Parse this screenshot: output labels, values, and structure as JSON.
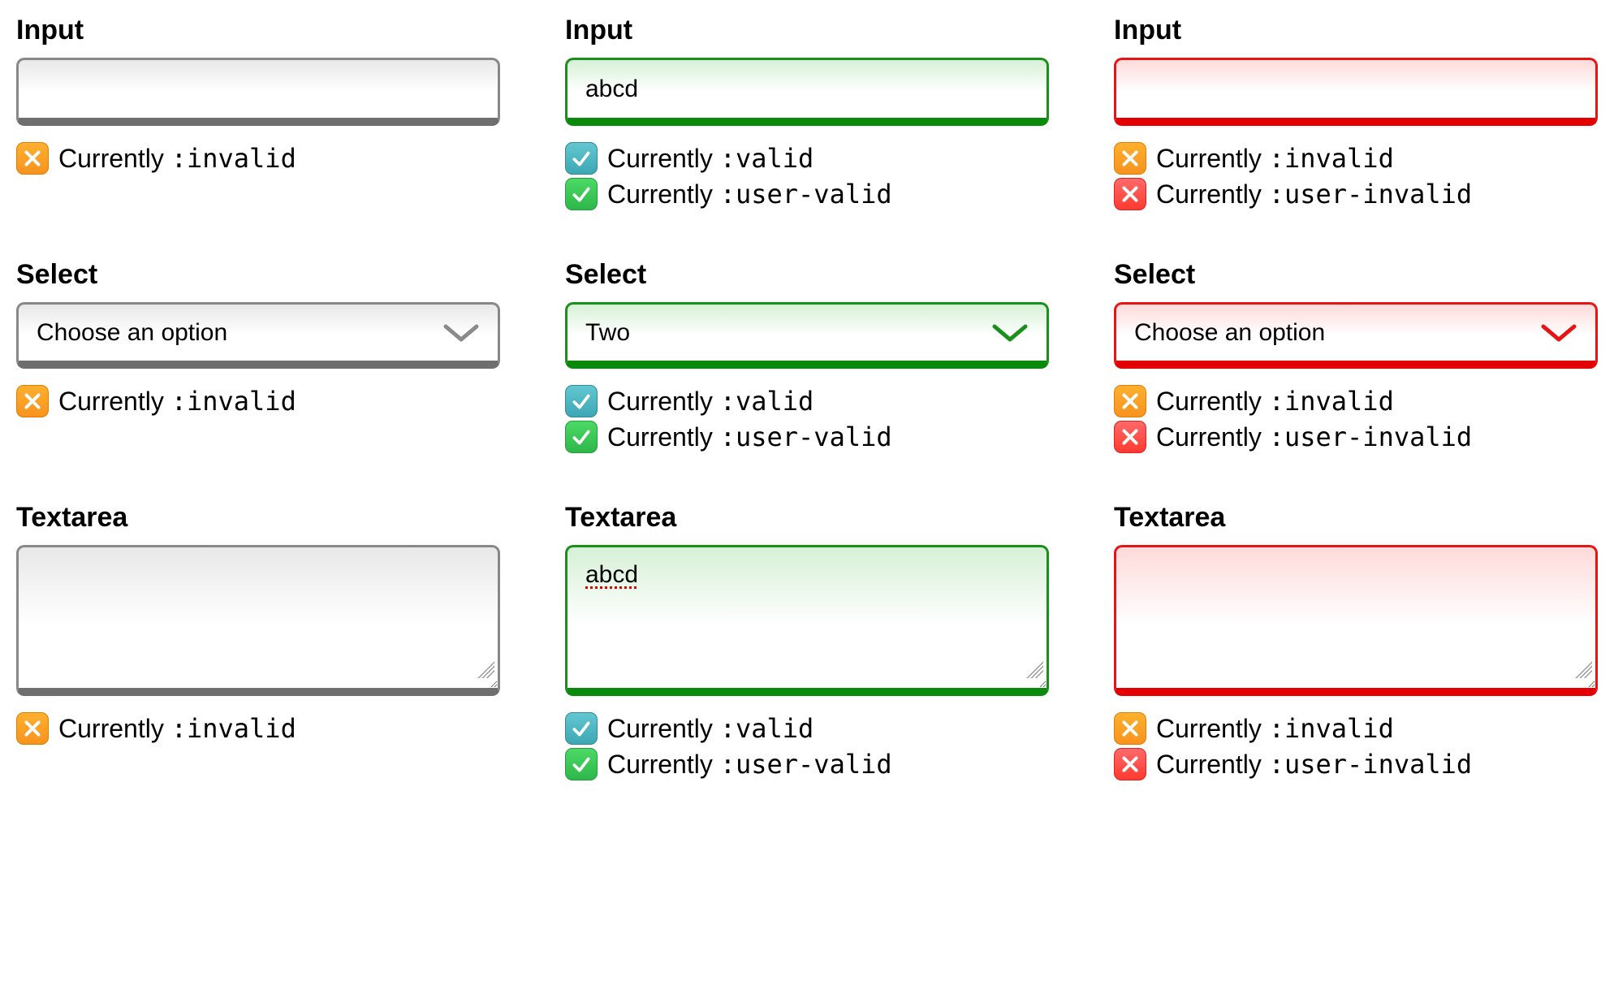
{
  "labels": {
    "input": "Input",
    "select": "Select",
    "textarea": "Textarea"
  },
  "status": {
    "prefix": "Currently ",
    "invalid": ":invalid",
    "valid": ":valid",
    "user_valid": ":user-valid",
    "user_invalid": ":user-invalid"
  },
  "select_placeholder": "Choose an option",
  "columns": [
    {
      "state": "neutral",
      "input_value": "",
      "select_value": "Choose an option",
      "textarea_value": "",
      "statuses": {
        "icons": [
          "orange-x"
        ],
        "codes": [
          "invalid"
        ]
      }
    },
    {
      "state": "valid",
      "input_value": "abcd",
      "select_value": "Two",
      "textarea_value": "abcd",
      "statuses": {
        "icons": [
          "teal-check",
          "green-check"
        ],
        "codes": [
          "valid",
          "user_valid"
        ]
      }
    },
    {
      "state": "invalid",
      "input_value": "",
      "select_value": "Choose an option",
      "textarea_value": "",
      "statuses": {
        "icons": [
          "orange-x",
          "red-x"
        ],
        "codes": [
          "invalid",
          "user_invalid"
        ]
      }
    }
  ]
}
